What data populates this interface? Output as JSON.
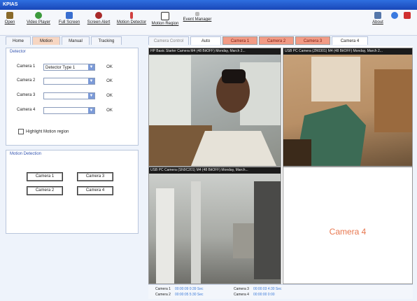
{
  "app": {
    "title": "KPIAS"
  },
  "toolbar": {
    "items": [
      {
        "label": "Open",
        "icon": "open-icon",
        "color": "#8a6a2a"
      },
      {
        "label": "Video Player",
        "icon": "video-player-icon",
        "color": "#3c9a3c"
      },
      {
        "label": "Full Screen",
        "icon": "full-screen-icon",
        "color": "#3a6fd0"
      },
      {
        "label": "Screen Alert",
        "icon": "screen-alert-icon",
        "color": "#a82a2a"
      },
      {
        "label": "Motion Detector",
        "icon": "motion-detector-icon",
        "color": "#d04040"
      },
      {
        "label": "Motion Region",
        "icon": "motion-region-icon",
        "color": "#333333"
      },
      {
        "label": "Event Manager",
        "icon": "event-manager-icon",
        "color": "#888888"
      }
    ],
    "right_items": [
      {
        "label": "About",
        "icon": "about-icon",
        "color": "#5577aa"
      },
      {
        "label": "",
        "icon": "help-icon",
        "color": "#3a7ae0"
      },
      {
        "label": "",
        "icon": "exit-icon",
        "color": "#d03030"
      }
    ]
  },
  "tabs": [
    "Home",
    "Motion",
    "Manual",
    "Tracking"
  ],
  "camera_tabs": [
    "Camera Control",
    "Auto",
    "Camera 1",
    "Camera 2",
    "Camera 3",
    "Camera 4"
  ],
  "detector": {
    "title": "Detector",
    "rows": [
      {
        "label": "Camera 1",
        "value": "Detector Type 1",
        "ok": "OK"
      },
      {
        "label": "Camera 2",
        "value": "",
        "ok": "OK"
      },
      {
        "label": "Camera 3",
        "value": "",
        "ok": "OK"
      },
      {
        "label": "Camera 4",
        "value": "",
        "ok": "OK"
      }
    ],
    "highlight": "Highlight Motion region"
  },
  "motion_detection": {
    "title": "Motion Detection",
    "buttons": [
      "Camera 1",
      "Camera 3",
      "Camera 2",
      "Camera 4"
    ]
  },
  "cameras": [
    {
      "header": "HP Basic Starter Camera   M4 (48 BitOFF) Monday, March 2..."
    },
    {
      "header": "USB PC Camera (ZR0301)  M4 (48 BitOFF) Monday, March 2..."
    },
    {
      "header": "USB PC Camera (SN9C201)  M4 (48 BitOFF) Monday, March..."
    },
    {
      "header": "",
      "placeholder": "Camera 4"
    }
  ],
  "status": [
    {
      "label": "Camera 1",
      "time": "00:00:09  0:39 Sec"
    },
    {
      "label": "Camera 3",
      "time": "00:00:03  4:30 Sec"
    },
    {
      "label": "Camera 2",
      "time": "00:00:05  5:30 Sec"
    },
    {
      "label": "Camera 4",
      "time": "00:00:00  0:00"
    }
  ]
}
